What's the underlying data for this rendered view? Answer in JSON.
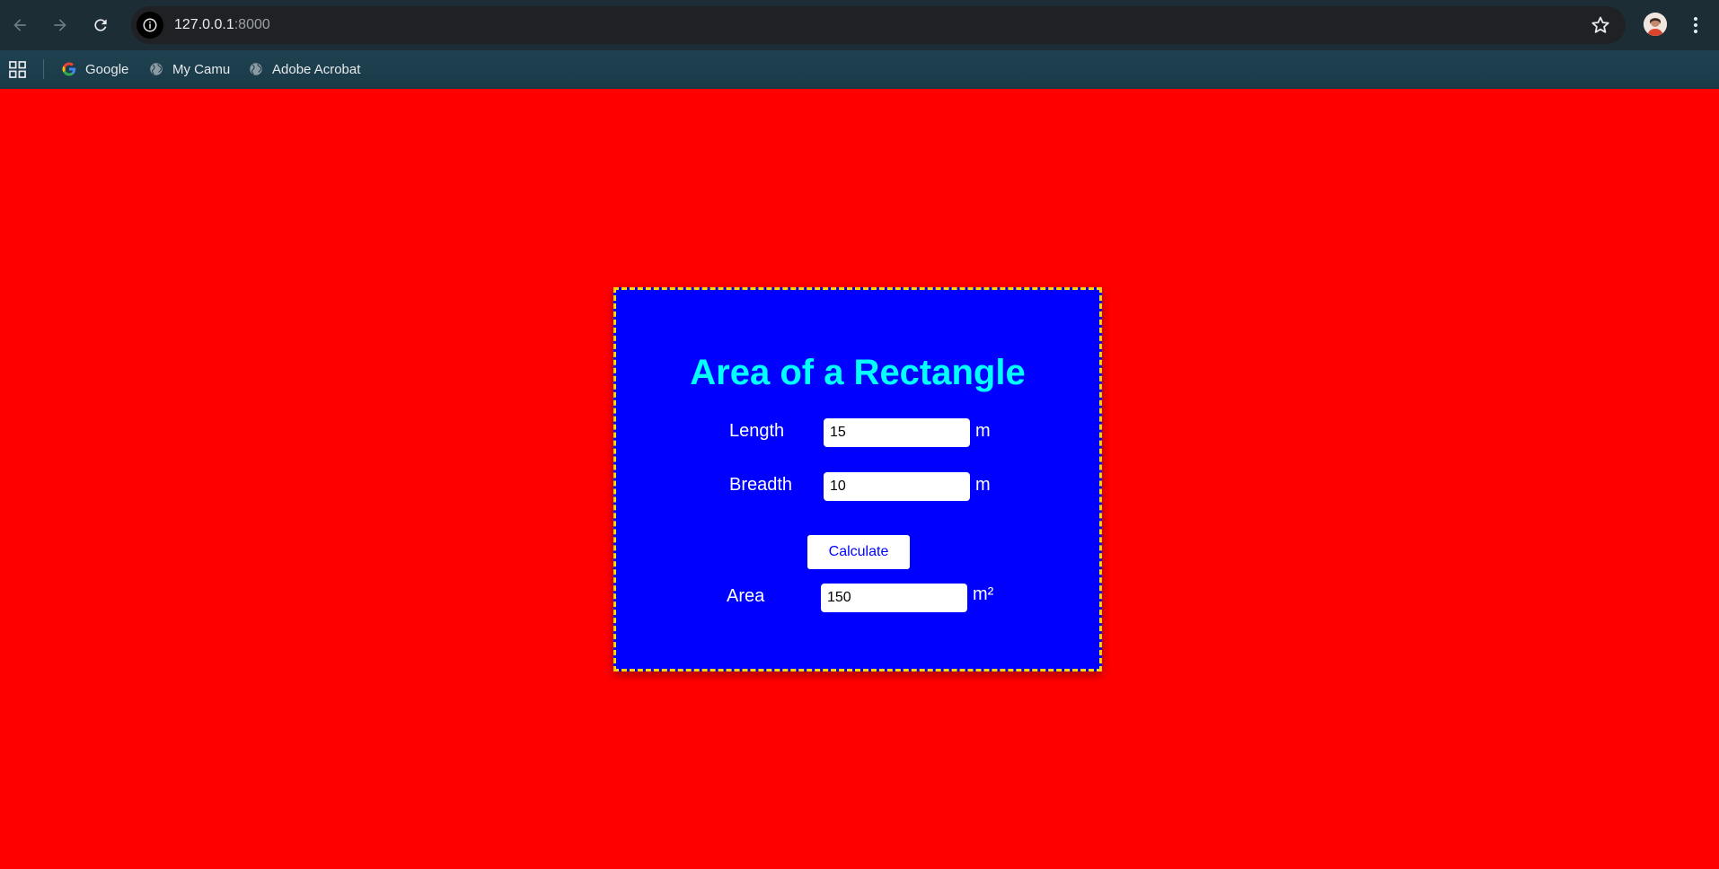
{
  "browser": {
    "url_host": "127.0.0.1",
    "url_port": ":8000",
    "bookmarks": [
      {
        "label": "Google",
        "icon": "google-icon"
      },
      {
        "label": "My Camu",
        "icon": "globe-icon"
      },
      {
        "label": "Adobe Acrobat",
        "icon": "globe-icon"
      }
    ]
  },
  "page": {
    "title": "Area of a Rectangle",
    "length": {
      "label": "Length",
      "value": "15",
      "unit": "m"
    },
    "breadth": {
      "label": "Breadth",
      "value": "10",
      "unit": "m"
    },
    "calculate_label": "Calculate",
    "area": {
      "label": "Area",
      "value": "150",
      "unit": "m²"
    }
  },
  "colors": {
    "page_background": "#ff0000",
    "card_background": "#0000ff",
    "card_border": "#ffd700",
    "title_color": "#00ffff",
    "button_text": "#0000ff"
  }
}
